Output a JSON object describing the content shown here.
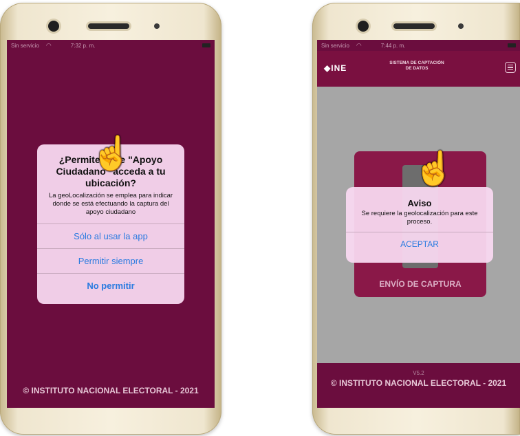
{
  "left_phone": {
    "status": {
      "carrier": "Sin servicio",
      "time": "7:32 p. m."
    },
    "dialog": {
      "title": "¿Permites que \"Apoyo Ciudadano\" acceda a tu ubicación?",
      "message": "La geoLocalización se emplea para indicar donde se está efectuando la captura del apoyo ciudadano",
      "buttons": [
        "Sólo al usar la app",
        "Permitir siempre",
        "No permitir"
      ]
    },
    "footer": "© INSTITUTO NACIONAL ELECTORAL - 2021"
  },
  "right_phone": {
    "status": {
      "carrier": "Sin servicio",
      "time": "7:44 p. m."
    },
    "appbar": {
      "logo": "INE",
      "title_line1": "SISTEMA DE CAPTACIÓN",
      "title_line2": "DE DATOS"
    },
    "card_label": "ENVÍO DE CAPTURA",
    "dialog": {
      "title": "Aviso",
      "message": "Se requiere la geolocalización para este proceso.",
      "button": "ACEPTAR"
    },
    "version": "V5.2",
    "footer": "© INSTITUTO NACIONAL ELECTORAL - 2021"
  },
  "colors": {
    "screen_bg": "#6b0d3e",
    "dialog_bg": "#f8d8f0",
    "link": "#2a7be0"
  },
  "icons": [
    "hand-pointer-icon",
    "menu-icon",
    "ine-logo-icon",
    "wifi-icon",
    "battery-icon"
  ]
}
